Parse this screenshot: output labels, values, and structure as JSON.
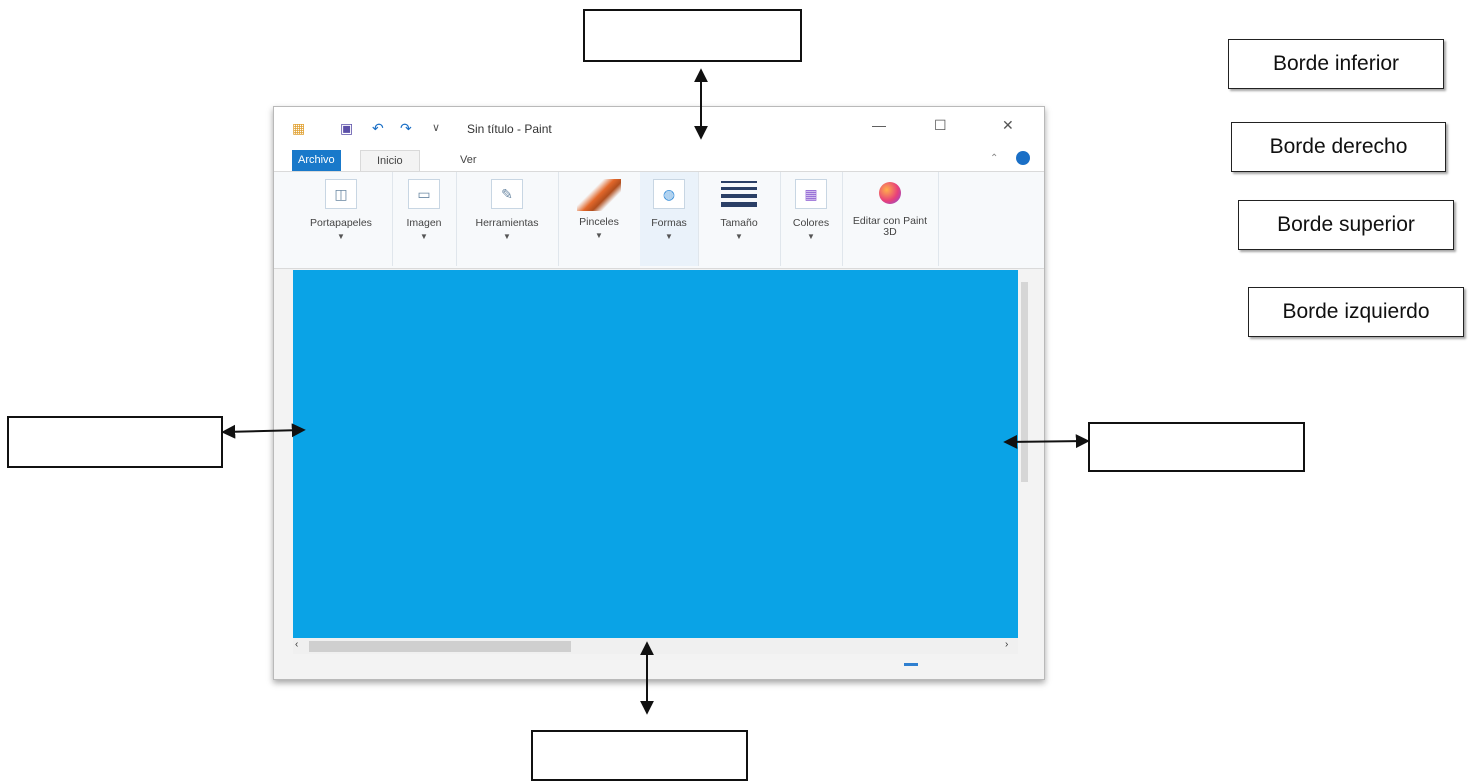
{
  "word_bank": [
    "Borde inferior",
    "Borde derecho",
    "Borde superior",
    "Borde izquierdo"
  ],
  "paint_window": {
    "title": "Sin título - Paint",
    "tabs": [
      "Archivo",
      "Inicio",
      "Ver"
    ],
    "ribbon_groups": [
      {
        "label": "Portapapeles",
        "icon": "clipboard-icon"
      },
      {
        "label": "Imagen",
        "icon": "image-icon"
      },
      {
        "label": "Herramientas",
        "icon": "tools-icon"
      },
      {
        "label": "Pinceles",
        "icon": "brushes-icon"
      },
      {
        "label": "Formas",
        "icon": "shapes-icon"
      },
      {
        "label": "Tamaño",
        "icon": "size-icon"
      },
      {
        "label": "Colores",
        "icon": "colors-icon"
      },
      {
        "label": "Editar con Paint 3D",
        "icon": "paint3d-icon"
      }
    ],
    "canvas_color": "#0aa3e6",
    "accent_color": "#1979ca"
  }
}
